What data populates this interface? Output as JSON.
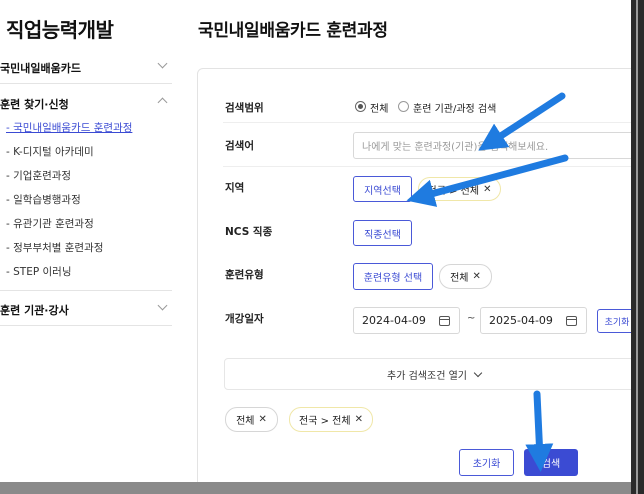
{
  "sidebar": {
    "title": "직업능력개발",
    "sections": [
      {
        "label": "국민내일배움카드"
      },
      {
        "label": "훈련 찾기·신청"
      },
      {
        "label": "훈련 기관·강사"
      }
    ],
    "items": [
      {
        "label": "- 국민내일배움카드 훈련과정"
      },
      {
        "label": "- K-디지털 아카데미"
      },
      {
        "label": "- 기업훈련과정"
      },
      {
        "label": "- 일학습병행과정"
      },
      {
        "label": "- 유관기관 훈련과정"
      },
      {
        "label": "- 정부부처별 훈련과정"
      },
      {
        "label": "- STEP 이러닝"
      }
    ]
  },
  "main": {
    "title": "국민내일배움카드 훈련과정"
  },
  "form": {
    "scope": {
      "label": "검색범위",
      "option_all": "전체",
      "option_inst": "훈련 기관/과정 검색",
      "selected": "전체"
    },
    "keyword": {
      "label": "검색어",
      "placeholder": "나에게 맞는 훈련과정(기관)을 검색해보세요."
    },
    "region": {
      "label": "지역",
      "button": "지역선택",
      "chip": "전국 > 전체"
    },
    "ncs": {
      "label": "NCS 직종",
      "button": "직종선택"
    },
    "type": {
      "label": "훈련유형",
      "button": "훈련유형 선택",
      "chip": "전체"
    },
    "date": {
      "label": "개강일자",
      "start": "2024-04-09",
      "separator": "~",
      "end": "2025-04-09",
      "reset": "초기화"
    },
    "expand_label": "추가 검색조건 열기",
    "selected_chips": [
      "전체",
      "전국 > 전체"
    ],
    "reset_button": "초기화",
    "search_button": "검색"
  },
  "colors": {
    "accent": "#3b4bd3",
    "annotation_arrow": "#1f7be0"
  },
  "icons": {
    "calendar": "calendar-icon",
    "chevron": "chevron-down-icon",
    "close": "close-icon",
    "arrow": "arrow-annotation-icon"
  }
}
